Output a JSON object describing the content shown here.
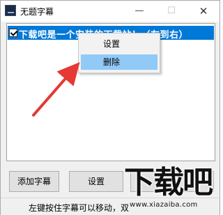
{
  "window": {
    "title": "无题字幕",
    "minimize_glyph": "—",
    "maximize_glyph": "☐",
    "close_glyph": "✕"
  },
  "list": {
    "items": [
      {
        "checked": true,
        "text": "下载吧是一个安装的下载站！（左到右）"
      }
    ]
  },
  "context_menu": {
    "items": [
      {
        "label": "设置"
      },
      {
        "label": "删除",
        "highlighted": true
      }
    ]
  },
  "buttons": {
    "add_label": "添加字幕",
    "settings_label": "设置"
  },
  "status_bar": {
    "text": "左键按住字幕可以移动，双"
  },
  "watermark": {
    "title": "下载吧",
    "url": "www.xiazaiba.com"
  },
  "colors": {
    "selection": "#0078d7",
    "menu_highlight": "#91c9f7",
    "annotation_arrow": "#e53935"
  },
  "icons": [
    "app-icon",
    "checkbox-checked-icon",
    "annotation-arrow"
  ]
}
